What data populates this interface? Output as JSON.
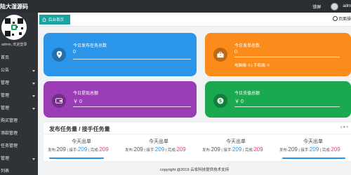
{
  "header": {
    "brand": "陆大湿源码",
    "lock_label": "锁屏",
    "username": "adm"
  },
  "sidebar": {
    "welcome": "admin, 欢迎登录",
    "items": [
      {
        "label": "首页",
        "has_caret": false
      },
      {
        "label": "公告",
        "has_caret": true
      },
      {
        "label": "管理",
        "has_caret": true
      },
      {
        "label": "管理",
        "has_caret": true
      },
      {
        "label": "管理",
        "has_caret": true
      },
      {
        "label": "购买管理",
        "has_caret": false
      },
      {
        "label": "添款管理",
        "has_caret": false
      },
      {
        "label": "任务管理",
        "has_caret": false
      },
      {
        "label": "管理",
        "has_caret": true
      },
      {
        "label": "列表",
        "has_caret": false
      }
    ]
  },
  "tabs": {
    "active": "后台首页",
    "right_label": "页面操"
  },
  "cards": [
    {
      "title": "今日发布任务总数",
      "value": "0",
      "extra": "",
      "color": "#2b95e9",
      "icon": "location-pin-icon"
    },
    {
      "title": "今日发单总数",
      "value": "0",
      "extra": "电脑端: 0 | 手机端: 0",
      "color": "#fb8c1c",
      "icon": "briefcase-icon"
    },
    {
      "title": "今日提现总额",
      "value": "￥ 0",
      "extra": "",
      "color": "#9b3cb7",
      "icon": "wallet-icon"
    },
    {
      "title": "今日充值总额",
      "value": "￥ 0",
      "extra": "",
      "color": "#1aa950",
      "icon": "dollar-coin-icon"
    }
  ],
  "panel": {
    "title": "发布任务量 / 接手任务量",
    "tools": "c ▾ ×",
    "stats": [
      {
        "title": "今天出单",
        "fabu_label": "发布:",
        "fabu": "209",
        "jieshou_label": "接手:",
        "jieshou": "209",
        "wancheng_label": "完成:",
        "wancheng": "209"
      },
      {
        "title": "今天出单",
        "fabu_label": "发布:",
        "fabu": "209",
        "jieshou_label": "接手:",
        "jieshou": "209",
        "wancheng_label": "完成:",
        "wancheng": "209"
      },
      {
        "title": "今天出单",
        "fabu_label": "发布:",
        "fabu": "209",
        "jieshou_label": "接手:",
        "jieshou": "209",
        "wancheng_label": "完成:",
        "wancheng": "209"
      },
      {
        "title": "今天出单",
        "fabu_label": "发布:",
        "fabu": "209",
        "jieshou_label": "接手:",
        "jieshou": "209",
        "wancheng_label": "完成:",
        "wancheng": "209"
      }
    ]
  },
  "footer": {
    "text": "copyright @2019 云妆科技提供技术支持"
  },
  "colors": {
    "accent": "#17a3a0",
    "sidebar_bg": "#2f3338",
    "topbar_bg": "#2a2e33"
  }
}
